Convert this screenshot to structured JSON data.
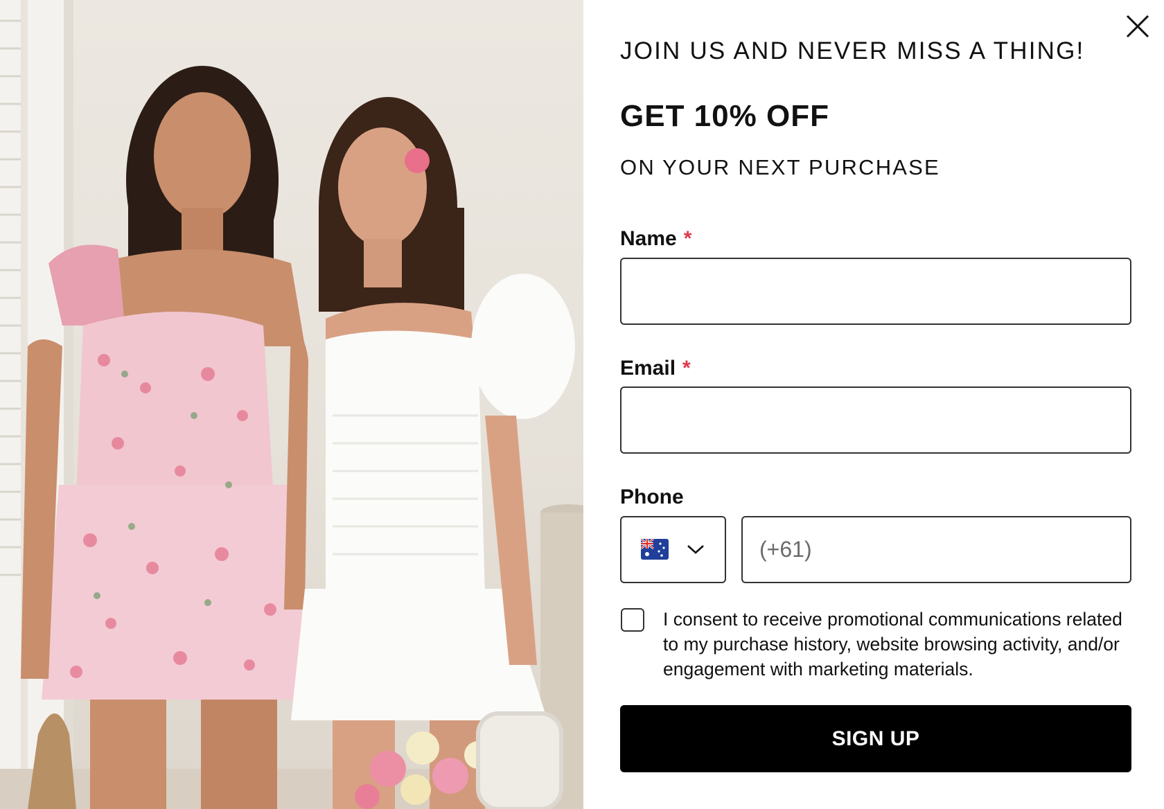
{
  "popup": {
    "headline": "JOIN US AND NEVER MISS A THING!",
    "offer": "GET 10% OFF",
    "subline": "ON YOUR NEXT PURCHASE",
    "image_alt": "Two women modelling a pink floral ruffled mini dress and a white puff-sleeve mini dress",
    "close_icon": "close-icon"
  },
  "form": {
    "name": {
      "label": "Name",
      "required_marker": "*",
      "value": "",
      "placeholder": ""
    },
    "email": {
      "label": "Email",
      "required_marker": "*",
      "value": "",
      "placeholder": ""
    },
    "phone": {
      "label": "Phone",
      "country_flag": "australia-flag-icon",
      "country_chevron": "chevron-down-icon",
      "value": "",
      "placeholder": "(+61)"
    },
    "consent": {
      "checked": false,
      "text": "I consent to receive promotional communications related to my purchase history, website browsing activity, and/or engagement with marketing materials."
    },
    "submit_label": "SIGN UP"
  },
  "colors": {
    "required": "#e0394b",
    "button_bg": "#000000",
    "button_text": "#ffffff",
    "border": "#333333"
  }
}
